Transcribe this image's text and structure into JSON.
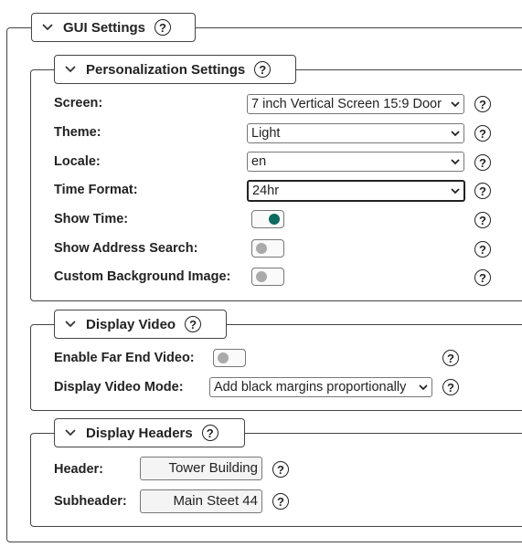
{
  "gui": {
    "title": "GUI Settings",
    "help": "?"
  },
  "personalization": {
    "title": "Personalization Settings",
    "help": "?",
    "screen": {
      "label": "Screen:",
      "value": "7 inch Vertical Screen 15:9 Door"
    },
    "theme": {
      "label": "Theme:",
      "value": "Light"
    },
    "locale": {
      "label": "Locale:",
      "value": "en"
    },
    "time_format": {
      "label": "Time Format:",
      "value": "24hr"
    },
    "show_time": {
      "label": "Show Time:",
      "on": true
    },
    "show_address_search": {
      "label": "Show Address Search:",
      "on": false
    },
    "custom_background": {
      "label": "Custom Background Image:",
      "on": false
    }
  },
  "display_video": {
    "title": "Display Video",
    "help": "?",
    "enable_far_end": {
      "label": "Enable Far End Video:",
      "on": false
    },
    "mode": {
      "label": "Display Video Mode:",
      "value": "Add black margins proportionally"
    }
  },
  "display_headers": {
    "title": "Display Headers",
    "help": "?",
    "header": {
      "label": "Header:",
      "value": "Tower Building"
    },
    "subheader": {
      "label": "Subheader:",
      "value": "Main Steet 44"
    }
  }
}
